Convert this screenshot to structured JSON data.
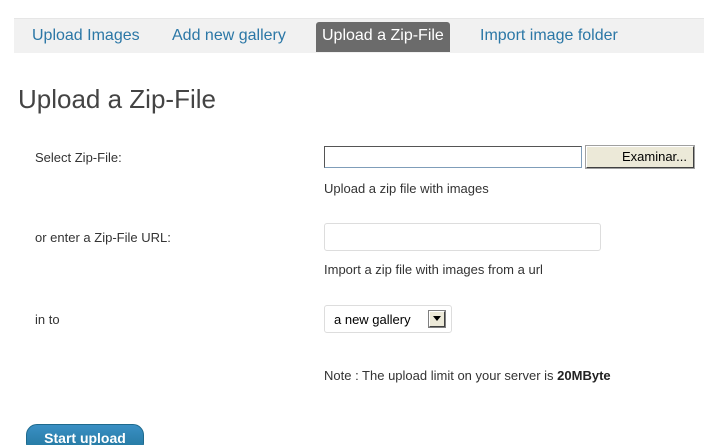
{
  "tabs": [
    {
      "label": "Upload Images",
      "active": false
    },
    {
      "label": "Add new gallery",
      "active": false
    },
    {
      "label": "Upload a Zip-File",
      "active": true
    },
    {
      "label": "Import image folder",
      "active": false
    }
  ],
  "heading": "Upload a Zip-File",
  "form": {
    "zip_file": {
      "label": "Select Zip-File:",
      "browse_label": "Examinar...",
      "hint": "Upload a zip file with images"
    },
    "zip_url": {
      "label": "or enter a Zip-File URL:",
      "value": "",
      "hint": "Import a zip file with images from a url"
    },
    "target": {
      "label": "in to",
      "selected": "a new gallery"
    },
    "note": {
      "prefix": "Note : The upload limit on your server is ",
      "limit": "20MByte"
    }
  },
  "start_button": "Start upload",
  "colors": {
    "link": "#2b77a6",
    "active_tab": "#6b6b6b",
    "primary_button": "#21759b"
  }
}
